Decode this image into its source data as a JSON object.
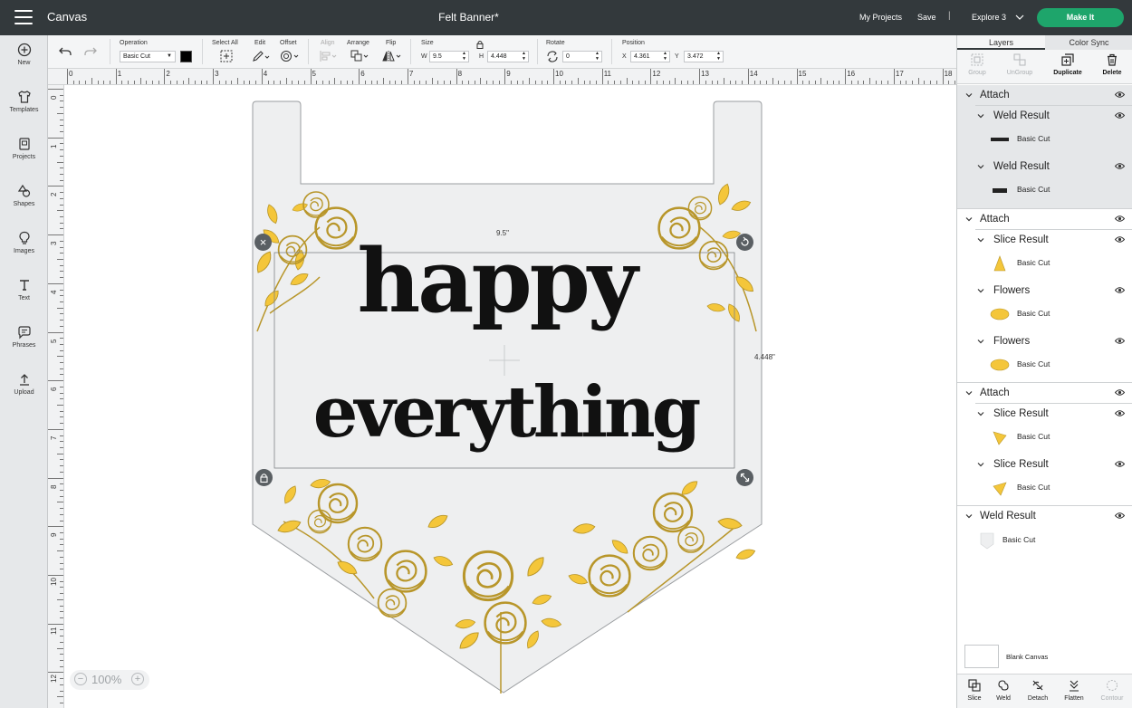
{
  "header": {
    "app_title": "Canvas",
    "doc_title": "Felt Banner*",
    "my_projects": "My Projects",
    "save": "Save",
    "separator": "|",
    "machine": "Explore 3",
    "make_it": "Make It",
    "make_it_color": "#1ea56b"
  },
  "sidebar": {
    "items": [
      {
        "label": "New",
        "icon": "plus-circle-icon"
      },
      {
        "label": "Templates",
        "icon": "shirt-icon"
      },
      {
        "label": "Projects",
        "icon": "projects-icon"
      },
      {
        "label": "Shapes",
        "icon": "shapes-icon"
      },
      {
        "label": "Images",
        "icon": "bulb-icon"
      },
      {
        "label": "Text",
        "icon": "text-icon"
      },
      {
        "label": "Phrases",
        "icon": "chat-icon"
      },
      {
        "label": "Upload",
        "icon": "upload-icon"
      }
    ]
  },
  "toolbar": {
    "operation_label": "Operation",
    "operation_value": "Basic Cut",
    "select_all": "Select All",
    "edit": "Edit",
    "offset": "Offset",
    "align": "Align",
    "arrange": "Arrange",
    "flip": "Flip",
    "size": "Size",
    "w_label": "W",
    "w_value": "9.5",
    "h_label": "H",
    "h_value": "4.448",
    "rotate": "Rotate",
    "rotate_value": "0",
    "position": "Position",
    "x_label": "X",
    "x_value": "4.361",
    "y_label": "Y",
    "y_value": "3.472"
  },
  "canvas": {
    "ruler_h": [
      "0",
      "1",
      "2",
      "3",
      "4",
      "5",
      "6",
      "7",
      "8",
      "9",
      "10",
      "11",
      "12",
      "13",
      "14",
      "15",
      "16",
      "17",
      "18"
    ],
    "ruler_v": [
      "0",
      "1",
      "2",
      "3",
      "4",
      "5",
      "6",
      "7",
      "8",
      "9",
      "10",
      "11",
      "12"
    ],
    "width_readout": "9.5\"",
    "height_readout": "4.448\"",
    "text_line1": "happy",
    "text_line2": "everything",
    "zoom_value": "100%",
    "zoom_minus": "−",
    "zoom_plus": "+",
    "flower_color": "#f4c63a"
  },
  "right_panel": {
    "tab_layers": "Layers",
    "tab_color_sync": "Color Sync",
    "tools": {
      "group": "Group",
      "ungroup": "UnGroup",
      "duplicate": "Duplicate",
      "delete": "Delete"
    },
    "layers": [
      {
        "type": "group",
        "label": "Attach"
      },
      {
        "type": "sub",
        "label": "Weld Result"
      },
      {
        "type": "leaf",
        "label": "Basic Cut"
      },
      {
        "type": "sub",
        "label": "Weld Result"
      },
      {
        "type": "leaf",
        "label": "Basic Cut"
      },
      {
        "type": "group",
        "label": "Attach"
      },
      {
        "type": "sub",
        "label": "Slice Result"
      },
      {
        "type": "leaf",
        "label": "Basic Cut"
      },
      {
        "type": "sub",
        "label": "Flowers"
      },
      {
        "type": "leaf",
        "label": "Basic Cut"
      },
      {
        "type": "sub",
        "label": "Flowers"
      },
      {
        "type": "leaf",
        "label": "Basic Cut"
      },
      {
        "type": "group",
        "label": "Attach"
      },
      {
        "type": "sub",
        "label": "Slice Result"
      },
      {
        "type": "leaf",
        "label": "Basic Cut"
      },
      {
        "type": "sub",
        "label": "Slice Result"
      },
      {
        "type": "leaf",
        "label": "Basic Cut"
      },
      {
        "type": "group",
        "label": "Weld Result"
      },
      {
        "type": "leaf",
        "label": "Basic Cut"
      }
    ],
    "blank_canvas": "Blank Canvas",
    "bottom": {
      "slice": "Slice",
      "weld": "Weld",
      "detach": "Detach",
      "flatten": "Flatten",
      "contour": "Contour"
    }
  }
}
